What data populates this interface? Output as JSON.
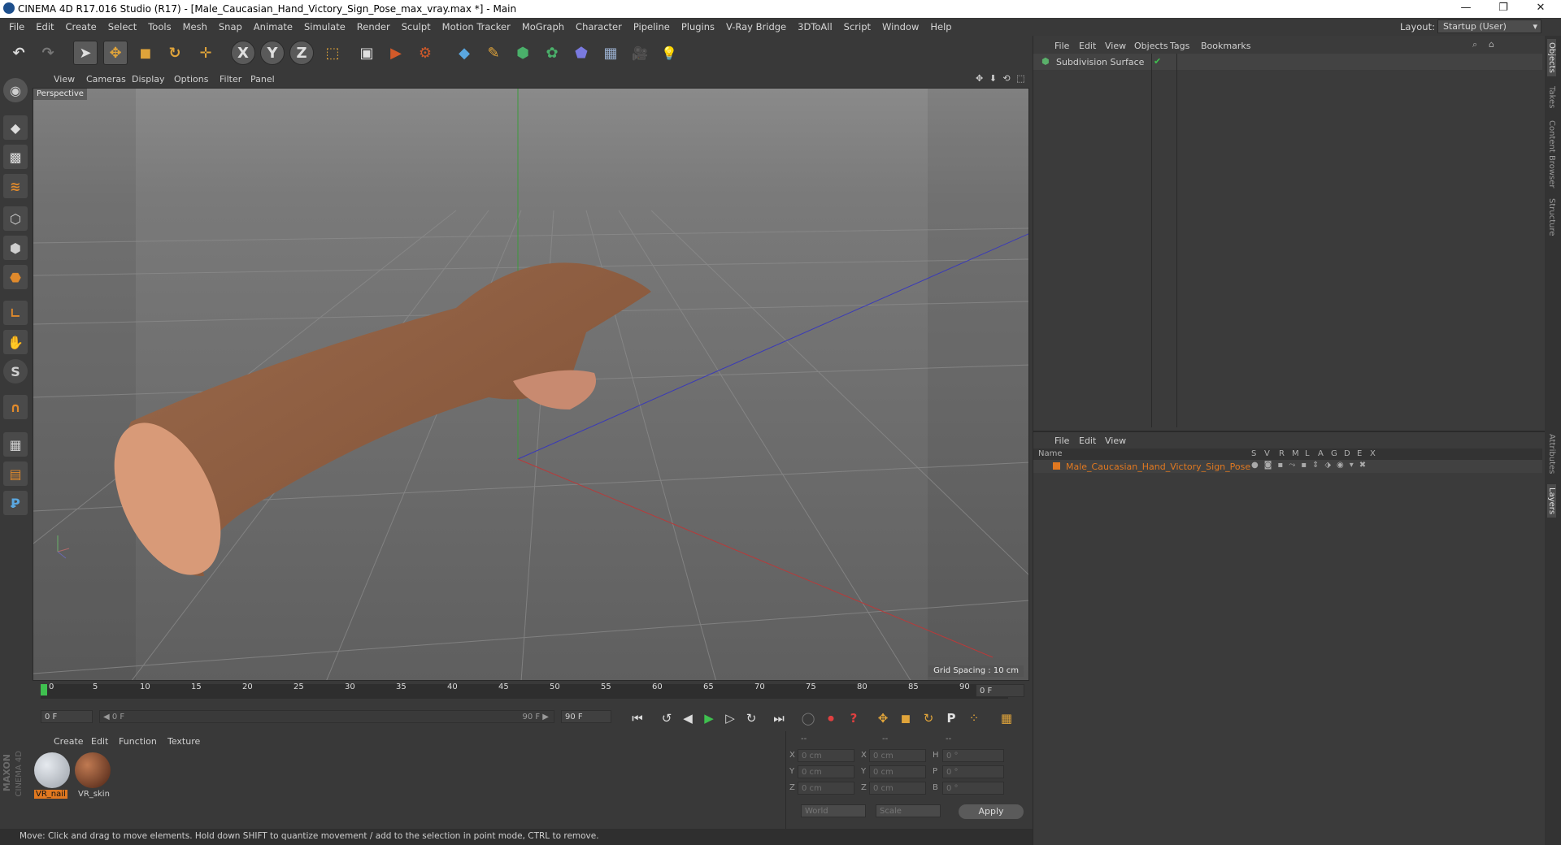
{
  "window": {
    "title": "CINEMA 4D R17.016 Studio (R17) - [Male_Caucasian_Hand_Victory_Sign_Pose_max_vray.max *] - Main",
    "controls": [
      "—",
      "❐",
      "✕"
    ]
  },
  "menu": [
    "File",
    "Edit",
    "Create",
    "Select",
    "Tools",
    "Mesh",
    "Snap",
    "Animate",
    "Simulate",
    "Render",
    "Sculpt",
    "Motion Tracker",
    "MoGraph",
    "Character",
    "Pipeline",
    "Plugins",
    "V-Ray Bridge",
    "3DToAll",
    "Script",
    "Window",
    "Help"
  ],
  "layout": {
    "label": "Layout:",
    "value": "Startup (User)"
  },
  "toolbar": {
    "undo": "↶",
    "redo": "↷",
    "select": "➤",
    "move": "✥",
    "scale": "◼",
    "rotate": "↻",
    "recent": "✛",
    "x": "X",
    "y": "Y",
    "z": "Z",
    "coord": "⬚",
    "render_view": "▣",
    "render_pv": "▶",
    "render_settings": "⚙",
    "cube": "◆",
    "pen": "✎",
    "subdiv": "⬢",
    "array": "✿",
    "deformer": "⬟",
    "floor": "▦",
    "camera": "🎥",
    "light": "💡"
  },
  "viewport": {
    "menu": [
      "View",
      "Cameras",
      "Display",
      "Options",
      "Filter",
      "Panel"
    ],
    "label": "Perspective",
    "grid_spacing": "Grid Spacing : 10 cm",
    "nav": "✥ ⬇ ⟲ ⬚"
  },
  "timeline": {
    "ticks": [
      "0",
      "5",
      "10",
      "15",
      "20",
      "25",
      "30",
      "35",
      "40",
      "45",
      "50",
      "55",
      "60",
      "65",
      "70",
      "75",
      "80",
      "85",
      "90"
    ],
    "end_field": "0 F",
    "start": "0 F",
    "slider_left": "◀ 0 F",
    "slider_right": "90 F ▶",
    "end": "90 F",
    "buttons": [
      "⏮",
      "↺",
      "◀",
      "▶",
      "▷",
      "↻",
      "⏭"
    ],
    "keys": [
      "◯",
      "⏺",
      "?",
      "✥",
      "◼",
      "↻",
      "P",
      "⁘",
      "▦"
    ]
  },
  "materials": {
    "menu": [
      "Create",
      "Edit",
      "Function",
      "Texture"
    ],
    "items": [
      {
        "name": "VR_nail",
        "selected": true,
        "color": "#b9bfc6"
      },
      {
        "name": "VR_skin",
        "selected": false,
        "color": "#7a3f23"
      }
    ],
    "brand_top": "MAXON",
    "brand_bottom": "CINEMA 4D"
  },
  "coordinates": {
    "headers": [
      "--",
      "--",
      "--"
    ],
    "rows": [
      {
        "a": "X",
        "av": "0 cm",
        "b": "X",
        "bv": "0 cm",
        "c": "H",
        "cv": "0 °"
      },
      {
        "a": "Y",
        "av": "0 cm",
        "b": "Y",
        "bv": "0 cm",
        "c": "P",
        "cv": "0 °"
      },
      {
        "a": "Z",
        "av": "0 cm",
        "b": "Z",
        "bv": "0 cm",
        "c": "B",
        "cv": "0 °"
      }
    ],
    "space": "World",
    "mode": "Scale",
    "apply": "Apply"
  },
  "objects": {
    "menu": [
      "File",
      "Edit",
      "View",
      "Objects",
      "Tags",
      "Bookmarks"
    ],
    "item": "Subdivision Surface"
  },
  "layers": {
    "menu": [
      "File",
      "Edit",
      "View"
    ],
    "name_header": "Name",
    "columns": [
      "S",
      "V",
      "R",
      "M",
      "L",
      "A",
      "G",
      "D",
      "E",
      "X"
    ],
    "item": "Male_Caucasian_Hand_Victory_Sign_Pose",
    "item_color": "#e07820"
  },
  "side_tabs": [
    "Objects",
    "Takes",
    "Content Browser",
    "Structure",
    "Attributes",
    "Layers"
  ],
  "status": "Move: Click and drag to move elements. Hold down SHIFT to quantize movement / add to the selection in point mode, CTRL to remove."
}
